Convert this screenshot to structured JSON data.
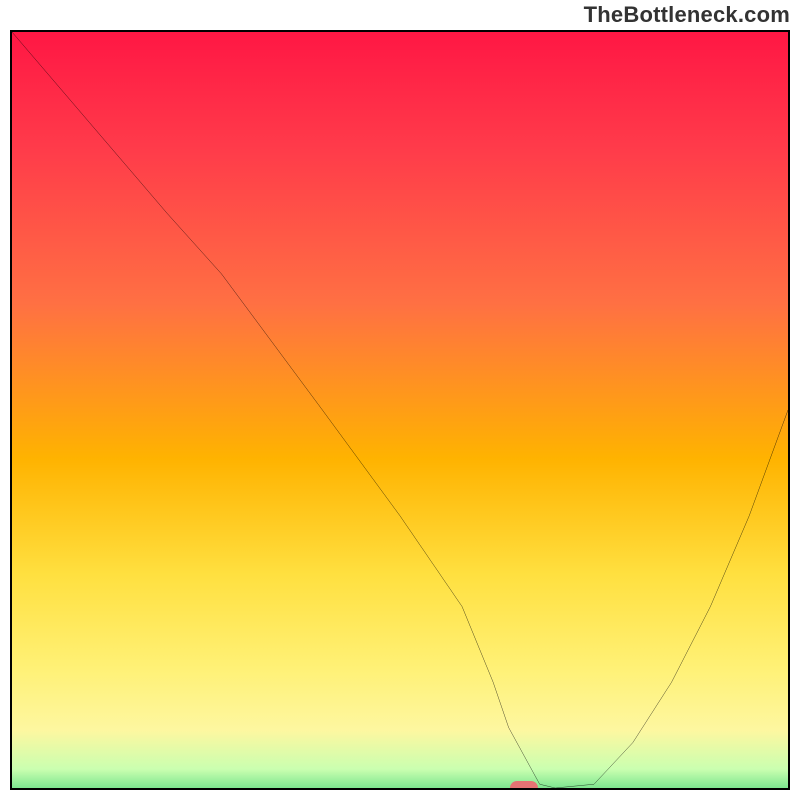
{
  "watermark": "TheBottleneck.com",
  "chart_data": {
    "type": "line",
    "title": "",
    "xlabel": "",
    "ylabel": "",
    "xlim": [
      0,
      100
    ],
    "ylim": [
      0,
      100
    ],
    "x": [
      0,
      5,
      10,
      20,
      27,
      40,
      50,
      58,
      62,
      64,
      68,
      70,
      75,
      80,
      85,
      90,
      95,
      100
    ],
    "values": [
      100,
      94,
      88,
      76,
      68,
      50,
      36,
      24,
      14,
      8,
      0.5,
      0,
      0.5,
      6,
      14,
      24,
      36,
      50
    ],
    "marker": {
      "x": 66,
      "y": 0,
      "color": "#e57373"
    },
    "gradient_stops": [
      {
        "pos": 0,
        "color": "#ff1744"
      },
      {
        "pos": 15,
        "color": "#ff3b4a"
      },
      {
        "pos": 35,
        "color": "#ff7043"
      },
      {
        "pos": 55,
        "color": "#ffb300"
      },
      {
        "pos": 70,
        "color": "#ffe040"
      },
      {
        "pos": 82,
        "color": "#fff176"
      },
      {
        "pos": 90,
        "color": "#fdf7a0"
      },
      {
        "pos": 95,
        "color": "#caffb0"
      },
      {
        "pos": 98,
        "color": "#6cdf88"
      },
      {
        "pos": 100,
        "color": "#00c853"
      }
    ]
  }
}
